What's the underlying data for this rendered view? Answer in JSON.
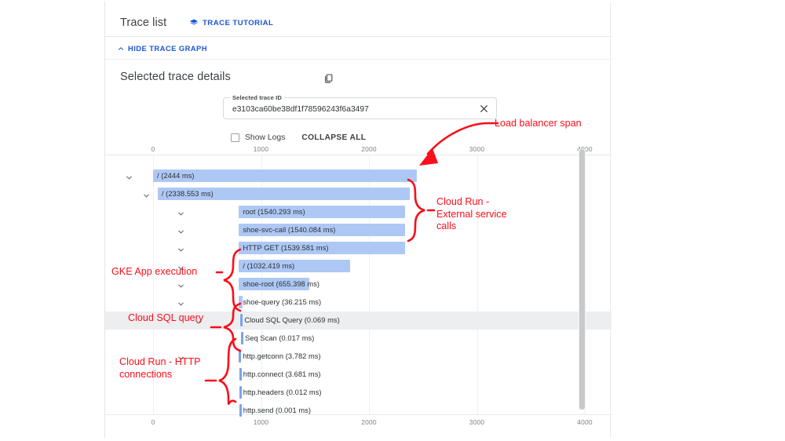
{
  "header": {
    "title": "Trace list",
    "tutorial_label": "TRACE TUTORIAL",
    "hide_graph_label": "HIDE TRACE GRAPH"
  },
  "details": {
    "heading": "Selected trace details",
    "trace_id_label": "Selected trace ID",
    "trace_id_value": "e3103ca60be38df1f78596243f6a3497"
  },
  "controls": {
    "show_logs_label": "Show Logs",
    "show_logs_checked": false,
    "collapse_all_label": "COLLAPSE ALL"
  },
  "colors": {
    "bar": "#aec8f5",
    "bar_thin": "#7ba3ee",
    "link": "#1a56d6",
    "annotation": "#fc0d1b",
    "row_highlight": "#eceef0"
  },
  "chart_data": {
    "type": "bar",
    "title": "Selected trace details",
    "xlabel": "",
    "ylabel": "",
    "xlim": [
      0,
      4000
    ],
    "ticks": [
      0,
      1000,
      2000,
      3000,
      4000
    ],
    "tick_labels": [
      "0",
      "1000",
      "2000",
      "3000",
      "4000"
    ],
    "unit": "ms",
    "grid": true,
    "legend": "none",
    "spans": [
      {
        "name": "/",
        "duration_ms": 2444,
        "label": "/ (2444 ms)",
        "depth": 0,
        "start_ms": 0,
        "expandable": true,
        "highlight": false
      },
      {
        "name": "/",
        "duration_ms": 2338.553,
        "label": "/ (2338.553 ms)",
        "depth": 1,
        "start_ms": 43,
        "expandable": true,
        "highlight": false
      },
      {
        "name": "root",
        "duration_ms": 1540.293,
        "label": "root (1540.293 ms)",
        "depth": 3,
        "start_ms": 795,
        "expandable": true,
        "highlight": false
      },
      {
        "name": "shoe-svc-call",
        "duration_ms": 1540.084,
        "label": "shoe-svc-call (1540.084 ms)",
        "depth": 3,
        "start_ms": 795,
        "expandable": true,
        "highlight": false
      },
      {
        "name": "HTTP GET",
        "duration_ms": 1539.581,
        "label": "HTTP GET (1539.581 ms)",
        "depth": 3,
        "start_ms": 795,
        "expandable": true,
        "highlight": false
      },
      {
        "name": "/",
        "duration_ms": 1032.419,
        "label": "/ (1032.419 ms)",
        "depth": 3,
        "start_ms": 795,
        "expandable": true,
        "highlight": false
      },
      {
        "name": "shoe-root",
        "duration_ms": 655.398,
        "label": "shoe-root (655.398 ms)",
        "depth": 3,
        "start_ms": 795,
        "expandable": true,
        "highlight": false
      },
      {
        "name": "shoe-query",
        "duration_ms": 36.215,
        "label": "shoe-query (36.215 ms)",
        "depth": 3,
        "start_ms": 795,
        "expandable": true,
        "highlight": false
      },
      {
        "name": "Cloud SQL Query",
        "duration_ms": 0.069,
        "label": "Cloud SQL Query (0.069 ms)",
        "depth": 4,
        "start_ms": 810,
        "expandable": true,
        "highlight": true
      },
      {
        "name": "Seq Scan",
        "duration_ms": 0.017,
        "label": "Seq Scan (0.017 ms)",
        "depth": 5,
        "start_ms": 815,
        "expandable": false,
        "highlight": false
      },
      {
        "name": "http.getconn",
        "duration_ms": 3.782,
        "label": "http.getconn (3.782 ms)",
        "depth": 3,
        "start_ms": 795,
        "expandable": true,
        "highlight": false
      },
      {
        "name": "http.connect",
        "duration_ms": 3.681,
        "label": "http.connect (3.681 ms)",
        "depth": 4,
        "start_ms": 798,
        "expandable": false,
        "highlight": false
      },
      {
        "name": "http.headers",
        "duration_ms": 0.012,
        "label": "http.headers (0.012 ms)",
        "depth": 4,
        "start_ms": 798,
        "expandable": false,
        "highlight": false
      },
      {
        "name": "http.send",
        "duration_ms": 0.001,
        "label": "http.send (0.001 ms)",
        "depth": 4,
        "start_ms": 798,
        "expandable": false,
        "highlight": false
      }
    ]
  },
  "annotations": [
    {
      "id": "load-balancer",
      "text": "Load balancer span",
      "kind": "arrow"
    },
    {
      "id": "cloud-run-ext",
      "text": "Cloud Run -\nExternal service\ncalls",
      "kind": "brace"
    },
    {
      "id": "gke-app",
      "text": "GKE App execution",
      "kind": "brace"
    },
    {
      "id": "cloud-sql",
      "text": "Cloud SQL query",
      "kind": "brace"
    },
    {
      "id": "cloud-run-http",
      "text": "Cloud Run - HTTP\nconnections",
      "kind": "brace"
    }
  ]
}
